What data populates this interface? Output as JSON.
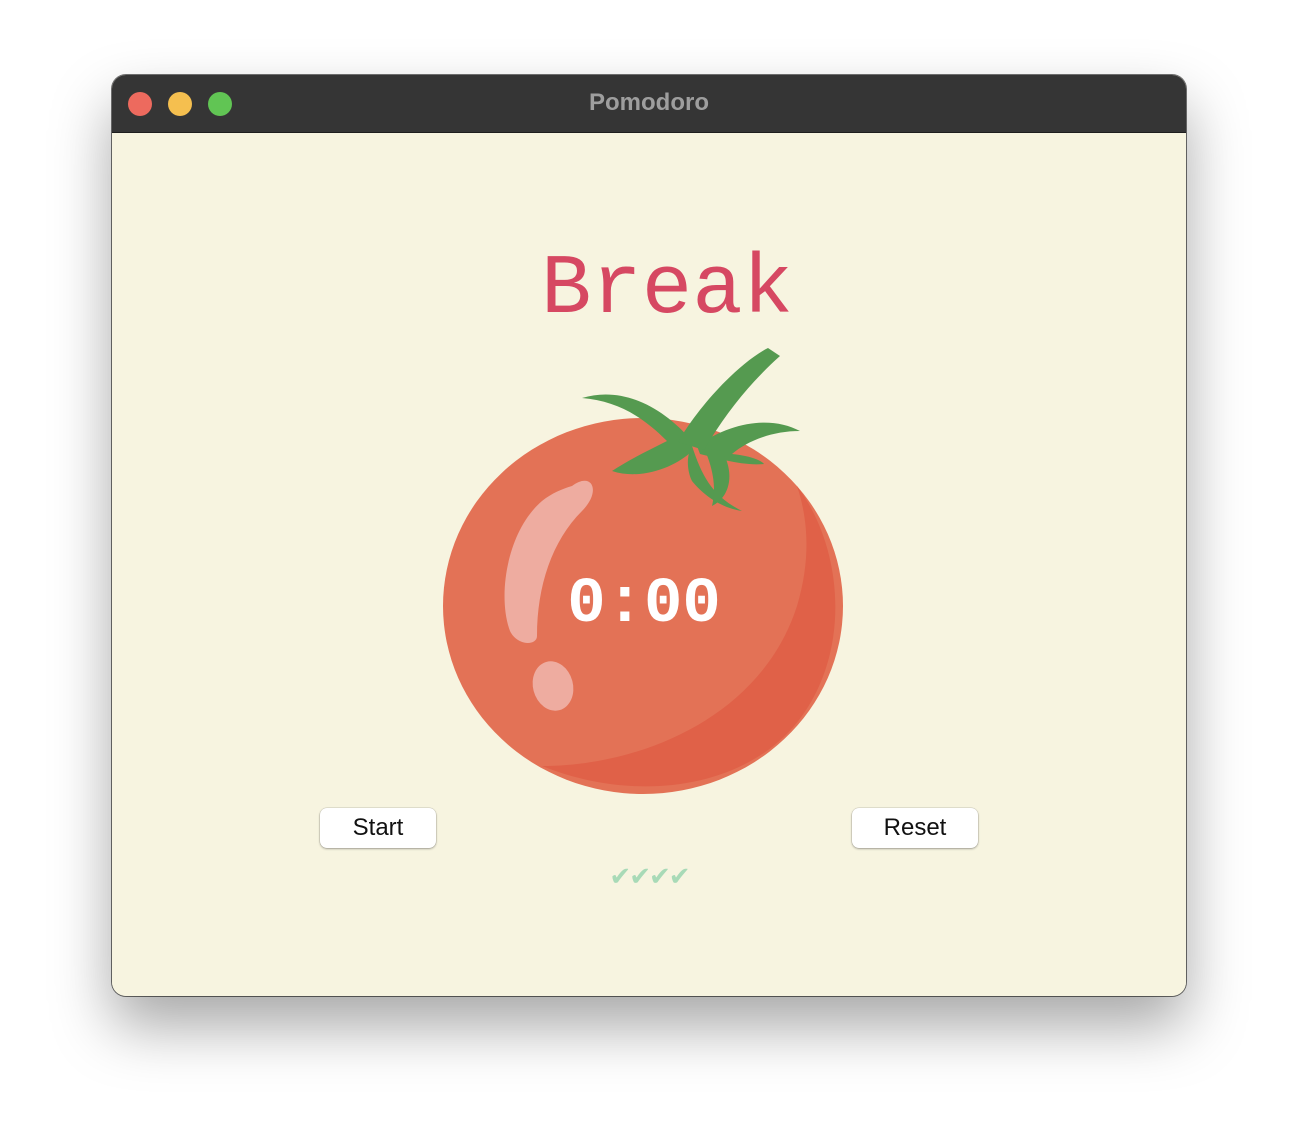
{
  "window": {
    "title": "Pomodoro",
    "controls": [
      "close",
      "minimize",
      "zoom"
    ]
  },
  "colors": {
    "background": "#f7f4e0",
    "title_text": "#d64862",
    "tomato_body": "#e37256",
    "tomato_shade": "#e06148",
    "stem": "#559a50",
    "check": "#a8dab7",
    "titlebar": "#353535"
  },
  "timer": {
    "mode_label": "Break",
    "time_display": "0:00",
    "completed_marks": "✔✔✔✔"
  },
  "buttons": {
    "start_label": "Start",
    "reset_label": "Reset"
  },
  "icons": {
    "tomato": "tomato-icon"
  }
}
